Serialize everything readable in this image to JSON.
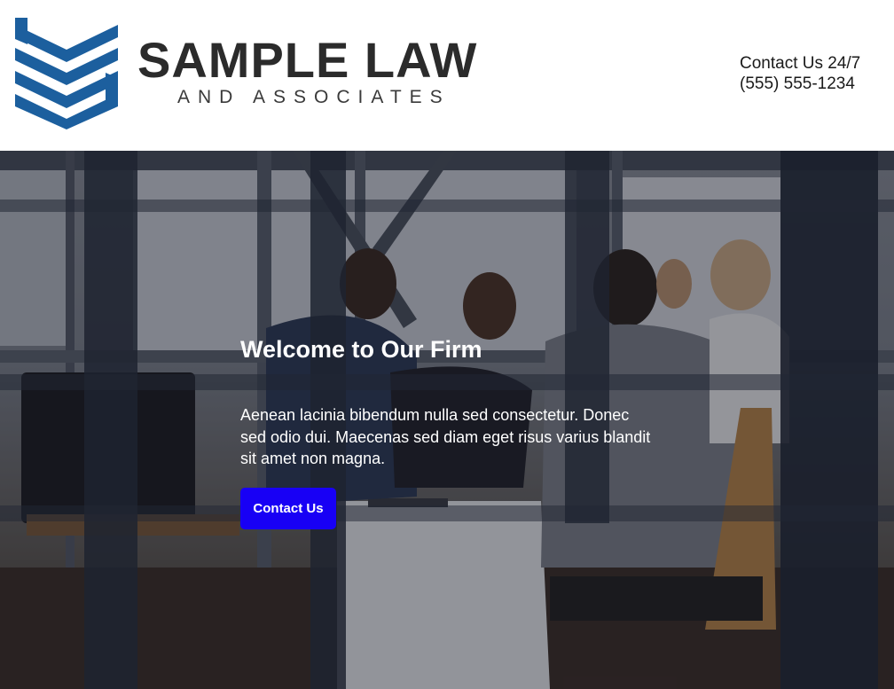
{
  "header": {
    "logo": {
      "title": "SAMPLE LAW",
      "subtitle": "AND ASSOCIATES",
      "mark_icon": "chevron-stack-logo-icon",
      "mark_color": "#1c5f9e"
    },
    "contact": {
      "line1": "Contact Us 24/7",
      "line2": "(555) 555-1234"
    }
  },
  "hero": {
    "background": "office-meeting-photo",
    "title": "Welcome to Our Firm",
    "text": "Aenean lacinia bibendum nulla sed consectetur. Donec sed odio dui. Maecenas sed diam eget risus varius blandit sit amet non magna.",
    "button_label": "Contact Us",
    "button_color": "#1800f5"
  }
}
